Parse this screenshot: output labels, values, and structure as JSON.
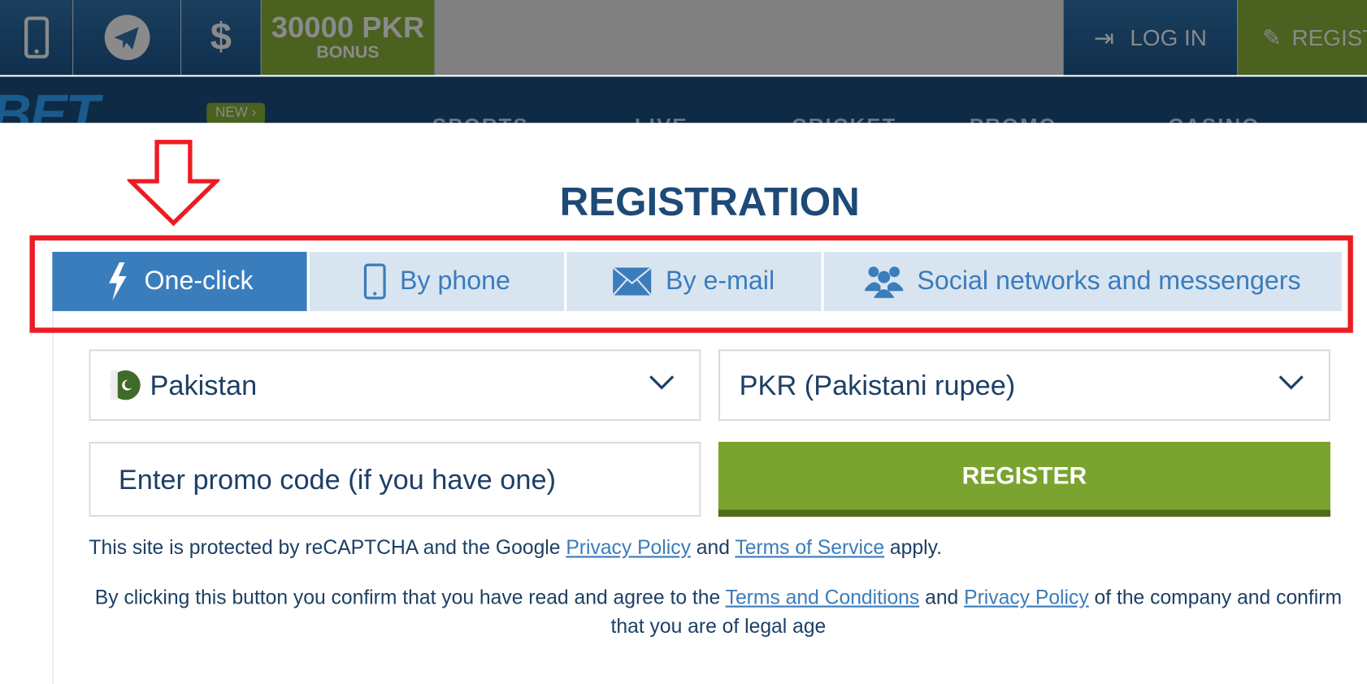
{
  "header": {
    "bonus_amount": "30000 PKR",
    "bonus_label": "BONUS",
    "login": "LOG IN",
    "register": "REGIST",
    "logo": "BET",
    "new_badge": "NEW"
  },
  "nav": [
    "SPORTS",
    "LIVE",
    "CRICKET",
    "PROMO",
    "CASINO"
  ],
  "modal": {
    "title": "REGISTRATION",
    "tabs": [
      {
        "label": "One-click",
        "icon": "lightning-icon",
        "active": true
      },
      {
        "label": "By phone",
        "icon": "phone-icon"
      },
      {
        "label": "By e-mail",
        "icon": "envelope-icon"
      },
      {
        "label": "Social networks and messengers",
        "icon": "users-icon"
      }
    ],
    "country": "Pakistan",
    "currency": "PKR (Pakistani rupee)",
    "promo_placeholder": "Enter promo code (if you have one)",
    "register_button": "REGISTER",
    "recaptcha": {
      "pre": "This site is protected by reCAPTCHA and the Google ",
      "privacy": "Privacy Policy",
      "mid": " and ",
      "terms": "Terms of Service",
      "post": " apply."
    },
    "consent": {
      "pre": "By clicking this button you confirm that you have read and agree to the ",
      "terms": "Terms and Conditions",
      "mid": " and ",
      "privacy": "Privacy Policy",
      "post": " of the company and confirm that you are of legal age"
    }
  },
  "colors": {
    "accent": "#3a7dbd",
    "register": "#7aa32f",
    "annotation": "#ec1c24",
    "title": "#1d4a76"
  }
}
